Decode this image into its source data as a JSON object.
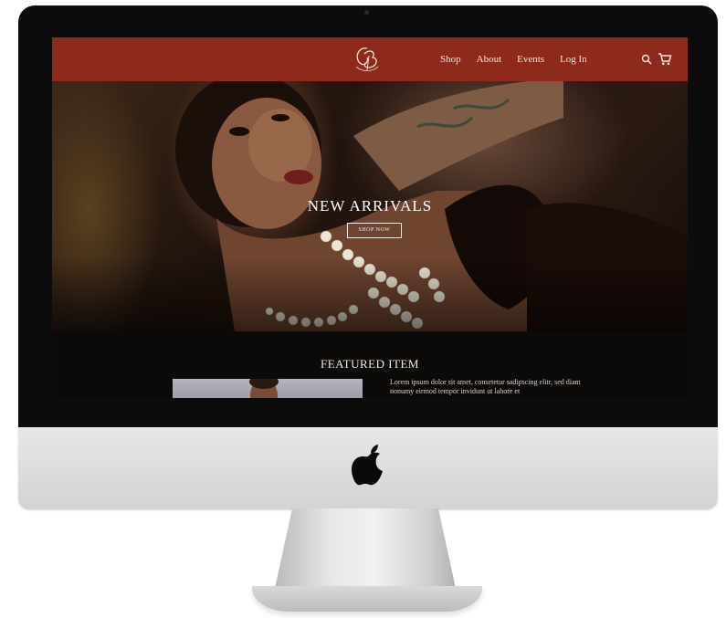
{
  "site": {
    "logo_alt": "CB monogram",
    "nav": {
      "links": [
        "Shop",
        "About",
        "Events",
        "Log In"
      ]
    },
    "hero": {
      "title": "NEW ARRIVALS",
      "button_label": "SHOP NOW"
    },
    "featured": {
      "title": "FEATURED ITEM",
      "description": "Lorem ipsum dolor sit amet, consetetur sadipscing elitr, sed diam nonumy eirmod tempor invidunt ut labore et"
    }
  },
  "colors": {
    "nav_background": "#8d2a1c",
    "page_background": "#0b0a09",
    "text_light": "#f2e4dc"
  },
  "icons": {
    "search": "search-icon",
    "cart": "cart-icon",
    "device_logo": "apple-icon"
  }
}
